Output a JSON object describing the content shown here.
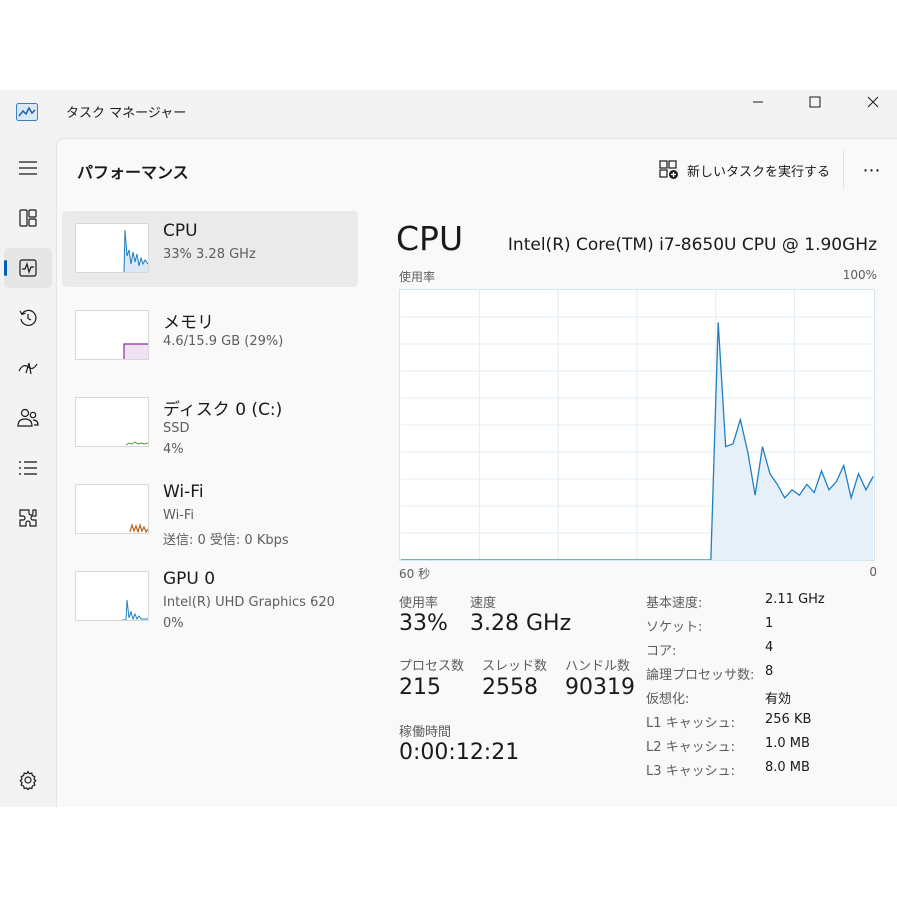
{
  "window": {
    "title": "タスク マネージャー"
  },
  "nav": {
    "items": [
      {
        "name": "nav-processes",
        "icon": "hamburger-icon"
      },
      {
        "name": "nav-processes-list",
        "icon": "processes-icon"
      },
      {
        "name": "nav-performance",
        "icon": "performance-icon",
        "active": true
      },
      {
        "name": "nav-app-history",
        "icon": "history-icon"
      },
      {
        "name": "nav-startup",
        "icon": "startup-icon"
      },
      {
        "name": "nav-users",
        "icon": "users-icon"
      },
      {
        "name": "nav-details",
        "icon": "details-icon"
      },
      {
        "name": "nav-services",
        "icon": "services-icon"
      },
      {
        "name": "nav-settings",
        "icon": "gear-icon"
      }
    ]
  },
  "header": {
    "title": "パフォーマンス",
    "run_task_label": "新しいタスクを実行する",
    "more_label": "⋯"
  },
  "resources": [
    {
      "name": "CPU",
      "sub1": "33%  3.28 GHz",
      "sub2": "",
      "color": "#1f7ec2"
    },
    {
      "name": "メモリ",
      "sub1": "4.6/15.9 GB (29%)",
      "sub2": "",
      "color": "#8b2aa0"
    },
    {
      "name": "ディスク 0 (C:)",
      "sub1": "SSD",
      "sub2": "4%",
      "color": "#4e9a3a"
    },
    {
      "name": "Wi-Fi",
      "sub1": "Wi-Fi",
      "sub2": "送信: 0  受信: 0 Kbps",
      "color": "#b5651d"
    },
    {
      "name": "GPU 0",
      "sub1": "Intel(R) UHD Graphics 620",
      "sub2": "0%",
      "color": "#1f7ec2"
    }
  ],
  "detail": {
    "title": "CPU",
    "model": "Intel(R) Core(TM) i7-8650U CPU @ 1.90GHz",
    "graph_label": "使用率",
    "graph_max_label": "100%",
    "axis_left": "60 秒",
    "axis_right": "0",
    "stats": {
      "usage_label": "使用率",
      "usage_value": "33%",
      "speed_label": "速度",
      "speed_value": "3.28 GHz",
      "processes_label": "プロセス数",
      "processes_value": "215",
      "threads_label": "スレッド数",
      "threads_value": "2558",
      "handles_label": "ハンドル数",
      "handles_value": "90319",
      "uptime_label": "稼働時間",
      "uptime_value": "0:00:12:21"
    },
    "info": [
      {
        "key": "基本速度:",
        "value": "2.11 GHz"
      },
      {
        "key": "ソケット:",
        "value": "1"
      },
      {
        "key": "コア:",
        "value": "4"
      },
      {
        "key": "論理プロセッサ数:",
        "value": "8"
      },
      {
        "key": "仮想化:",
        "value": "有効"
      },
      {
        "key": "L1 キャッシュ:",
        "value": "256 KB"
      },
      {
        "key": "L2 キャッシュ:",
        "value": "1.0 MB"
      },
      {
        "key": "L3 キャッシュ:",
        "value": "8.0 MB"
      }
    ]
  },
  "chart_data": {
    "type": "area",
    "x_range": [
      60,
      0
    ],
    "ylim": [
      0,
      100
    ],
    "values": [
      0,
      0,
      0,
      0,
      0,
      0,
      0,
      0,
      0,
      0,
      0,
      0,
      0,
      0,
      0,
      0,
      0,
      0,
      0,
      0,
      0,
      0,
      0,
      0,
      0,
      0,
      0,
      0,
      0,
      0,
      0,
      0,
      0,
      0,
      0,
      0,
      0,
      0,
      0,
      0,
      0,
      0,
      0,
      88,
      42,
      43,
      52,
      40,
      24,
      42,
      32,
      28,
      23,
      26,
      24,
      28,
      25,
      33,
      26,
      29,
      35,
      23,
      32,
      26,
      31
    ],
    "color": "#1f7ec2"
  }
}
